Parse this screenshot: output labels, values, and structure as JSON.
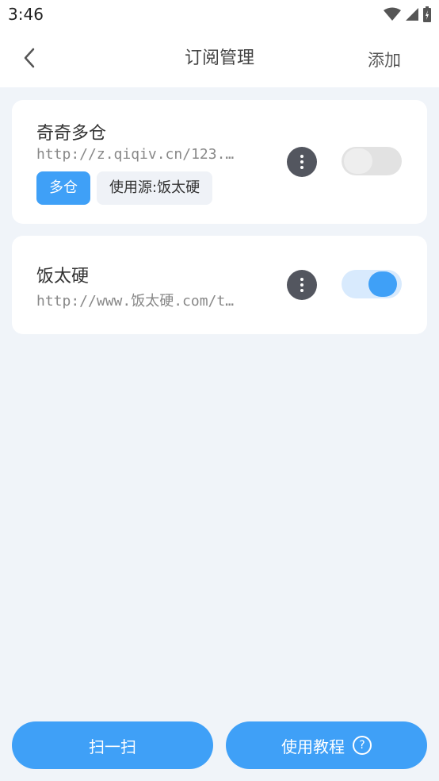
{
  "status_bar": {
    "time": "3:46"
  },
  "header": {
    "title": "订阅管理",
    "add_label": "添加"
  },
  "subscriptions": [
    {
      "name": "奇奇多仓",
      "url": "http://z.qiqiv.cn/123.…",
      "tags": [
        "多仓",
        "使用源:饭太硬"
      ],
      "enabled": false
    },
    {
      "name": "饭太硬",
      "url": "http://www.饭太硬.com/t…",
      "tags": [],
      "enabled": true
    }
  ],
  "bottom": {
    "scan_label": "扫一扫",
    "tutorial_label": "使用教程",
    "help_glyph": "?"
  },
  "colors": {
    "accent": "#3fa0f7",
    "background": "#f0f4f9"
  }
}
